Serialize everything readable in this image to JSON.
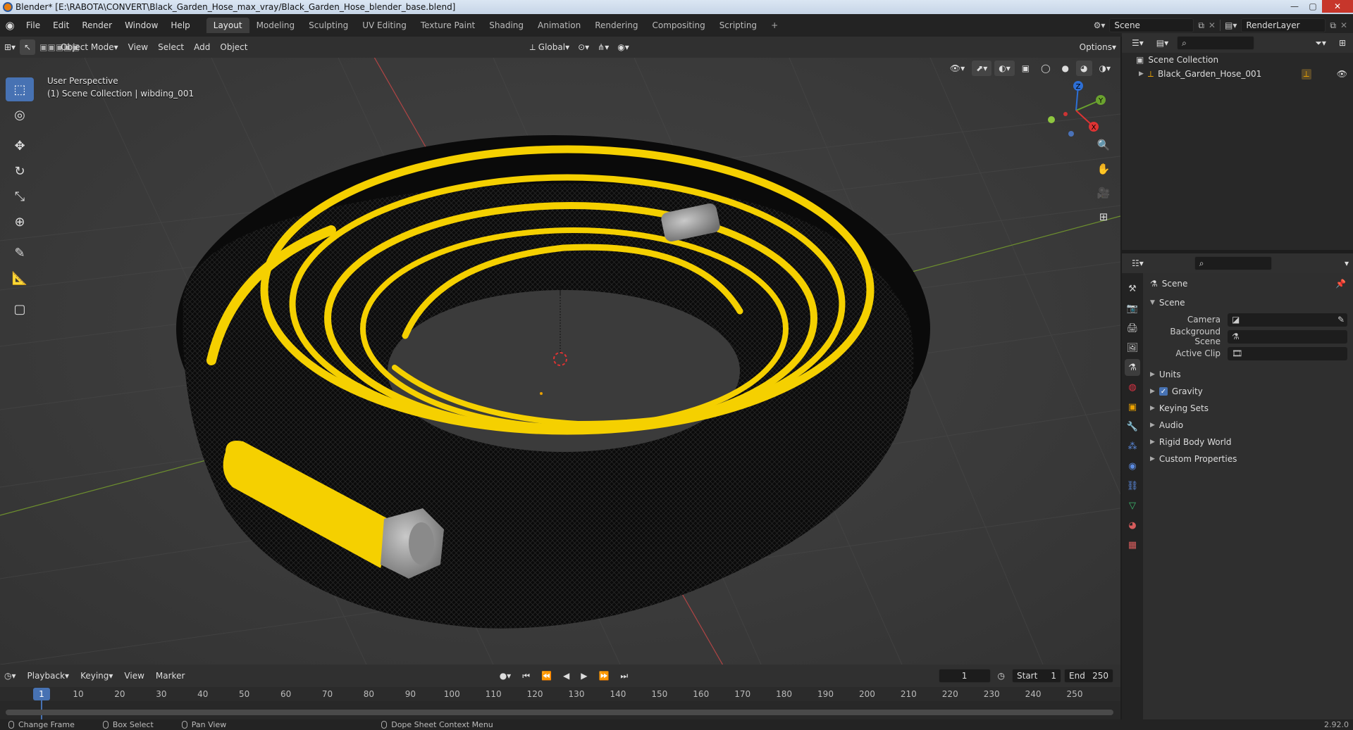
{
  "window": {
    "title": "Blender* [E:\\RABOTA\\CONVERT\\Black_Garden_Hose_max_vray/Black_Garden_Hose_blender_base.blend]"
  },
  "menu": [
    "File",
    "Edit",
    "Render",
    "Window",
    "Help"
  ],
  "workspaces": [
    "Layout",
    "Modeling",
    "Sculpting",
    "UV Editing",
    "Texture Paint",
    "Shading",
    "Animation",
    "Rendering",
    "Compositing",
    "Scripting"
  ],
  "active_workspace": "Layout",
  "scene_field": "Scene",
  "renderlayer_field": "RenderLayer",
  "viewport_header": {
    "mode": "Object Mode",
    "menus": [
      "View",
      "Select",
      "Add",
      "Object"
    ],
    "transform_orientation": "Global",
    "options": "Options"
  },
  "viewport_info": {
    "line1": "User Perspective",
    "line2": "(1) Scene Collection | wibding_001"
  },
  "gizmo": {
    "z": "Z",
    "y": "Y",
    "x": "X"
  },
  "timeline": {
    "menus": [
      "Playback",
      "Keying",
      "View",
      "Marker"
    ],
    "current_frame": "1",
    "start_label": "Start",
    "start": "1",
    "end_label": "End",
    "end": "250",
    "ticks": [
      "1",
      "10",
      "20",
      "30",
      "40",
      "50",
      "60",
      "70",
      "80",
      "90",
      "100",
      "110",
      "120",
      "130",
      "140",
      "150",
      "160",
      "170",
      "180",
      "190",
      "200",
      "210",
      "220",
      "230",
      "240",
      "250"
    ]
  },
  "statusbar": {
    "change_frame": "Change Frame",
    "box_select": "Box Select",
    "pan_view": "Pan View",
    "context_menu": "Dope Sheet Context Menu",
    "version": "2.92.0"
  },
  "outliner": {
    "collection": "Scene Collection",
    "object": "Black_Garden_Hose_001"
  },
  "properties": {
    "context": "Scene",
    "panel": "Scene",
    "camera_label": "Camera",
    "bg_scene_label": "Background Scene",
    "active_clip_label": "Active Clip",
    "sections": [
      "Units",
      "Gravity",
      "Keying Sets",
      "Audio",
      "Rigid Body World",
      "Custom Properties"
    ]
  },
  "colors": {
    "accent": "#4772b3",
    "hose_stripe": "#f5d000",
    "hose_body": "#0b0b0b"
  }
}
